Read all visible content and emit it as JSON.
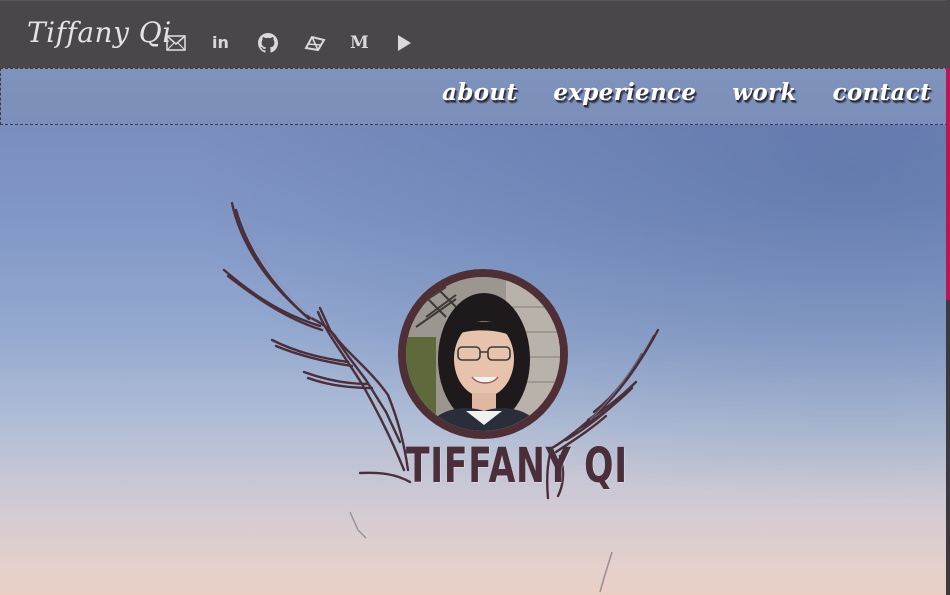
{
  "brand": {
    "name": "Tiffany Qi"
  },
  "social": [
    {
      "name": "email-icon",
      "label": ""
    },
    {
      "name": "linkedin-icon",
      "label": "in"
    },
    {
      "name": "github-icon",
      "label": ""
    },
    {
      "name": "dribbble-icon",
      "label": ""
    },
    {
      "name": "medium-icon",
      "label": "M"
    },
    {
      "name": "play-icon",
      "label": ""
    }
  ],
  "nav": {
    "items": [
      "about",
      "experience",
      "work",
      "contact"
    ]
  },
  "hero": {
    "logo_text": "TIFFANY QI",
    "avatar_alt": "Tiffany Qi portrait"
  },
  "colors": {
    "topbar": "#4b4649",
    "navbar": "#7f92bb",
    "logo_ink": "#4a2f3a",
    "accent_edge": "#b8184f"
  }
}
